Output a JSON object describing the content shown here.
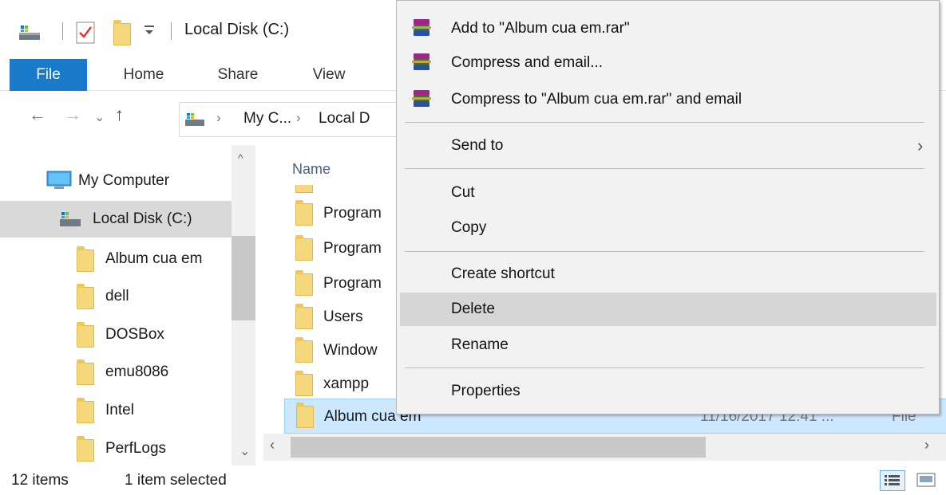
{
  "window": {
    "title": "Local Disk (C:)"
  },
  "ribbon": {
    "tabs": [
      "File",
      "Home",
      "Share",
      "View"
    ]
  },
  "address": {
    "parts": [
      "My C...",
      "Local D"
    ]
  },
  "nav": {
    "items": [
      {
        "label": "My Computer"
      },
      {
        "label": "Local Disk (C:)"
      },
      {
        "label": "Album cua em"
      },
      {
        "label": "dell"
      },
      {
        "label": "DOSBox"
      },
      {
        "label": "emu8086"
      },
      {
        "label": "Intel"
      },
      {
        "label": "PerfLogs"
      }
    ]
  },
  "content": {
    "column_name": "Name",
    "rows": [
      {
        "label": "Program"
      },
      {
        "label": "Program"
      },
      {
        "label": "Program"
      },
      {
        "label": "Users"
      },
      {
        "label": "Window"
      },
      {
        "label": "xampp"
      },
      {
        "label": "Album cua em",
        "date": "11/16/2017 12:41 ...",
        "type": "File"
      }
    ]
  },
  "context_menu": {
    "add_to": "Add to \"Album cua em.rar\"",
    "compress_email": "Compress and email...",
    "compress_to_email": "Compress to \"Album cua em.rar\" and email",
    "send_to": "Send to",
    "cut": "Cut",
    "copy": "Copy",
    "create_shortcut": "Create shortcut",
    "delete": "Delete",
    "rename": "Rename",
    "properties": "Properties"
  },
  "status": {
    "items": "12 items",
    "selected": "1 item selected"
  },
  "colors": {
    "accent": "#1979ca",
    "selection": "#cce8ff",
    "folder": "#f5d77c"
  }
}
